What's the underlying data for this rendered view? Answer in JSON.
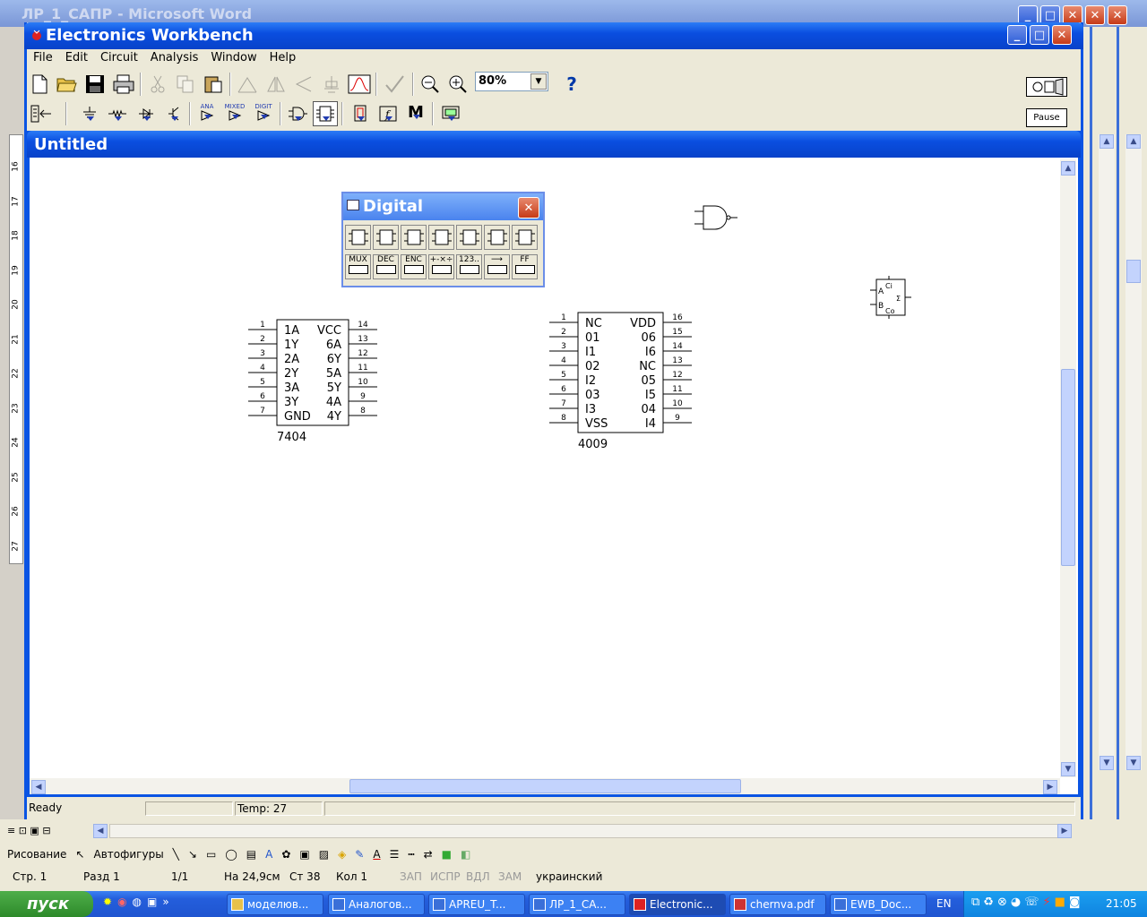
{
  "word": {
    "title": "ЛР_1_САПР - Microsoft Word",
    "status": [
      "Стр. 1",
      "Разд 1",
      "1/1",
      "На 24,9см",
      "Ст 38",
      "Кол 1",
      "ЗАП",
      "ИСПР",
      "ВДЛ",
      "ЗАМ",
      "украинский"
    ],
    "drawing_label": "Рисование",
    "autoshapes_label": "Автофигуры",
    "ruler_numbers": [
      "16",
      "17",
      "18",
      "19",
      "20",
      "21",
      "22",
      "23",
      "24",
      "25",
      "26",
      "27"
    ]
  },
  "ewb": {
    "title": "Electronics Workbench",
    "menu": [
      "File",
      "Edit",
      "Circuit",
      "Analysis",
      "Window",
      "Help"
    ],
    "zoom": "80%",
    "help_label": "?",
    "pause_label": "Pause",
    "parts_bins": [
      "ANA",
      "MIXED",
      "DIGIT"
    ],
    "m_label": "M"
  },
  "circuit_window": {
    "title": "Untitled"
  },
  "status": {
    "ready": "Ready",
    "temp": "Temp:  27"
  },
  "digital_palette": {
    "title": "Digital",
    "bottom_labels": [
      "MUX",
      "DEC",
      "ENC",
      "+-×÷",
      "123..",
      "⟶",
      "FF"
    ]
  },
  "chip_7404": {
    "name": "7404",
    "left_labels": [
      "1A",
      "1Y",
      "2A",
      "2Y",
      "3A",
      "3Y",
      "GND"
    ],
    "right_labels": [
      "VCC",
      "6A",
      "6Y",
      "5A",
      "5Y",
      "4A",
      "4Y"
    ],
    "left_pins": [
      "1",
      "2",
      "3",
      "4",
      "5",
      "6",
      "7"
    ],
    "right_pins": [
      "14",
      "13",
      "12",
      "11",
      "10",
      "9",
      "8"
    ]
  },
  "chip_4009": {
    "name": "4009",
    "left_labels": [
      "NC",
      "01",
      "I1",
      "02",
      "I2",
      "03",
      "I3",
      "VSS"
    ],
    "right_labels": [
      "VDD",
      "06",
      "I6",
      "NC",
      "05",
      "I5",
      "04",
      "I4"
    ],
    "left_pins": [
      "1",
      "2",
      "3",
      "4",
      "5",
      "6",
      "7",
      "8"
    ],
    "right_pins": [
      "16",
      "15",
      "14",
      "13",
      "12",
      "11",
      "10",
      "9"
    ]
  },
  "adder": {
    "a": "A",
    "b": "B",
    "ci": "Ci",
    "co": "Co",
    "sum": "Σ"
  },
  "taskbar": {
    "start": "пуск",
    "tasks": [
      "моделюв...",
      "Аналогов...",
      "APREU_T...",
      "ЛР_1_СА...",
      "Electronic...",
      "chernva.pdf",
      "EWB_Doc..."
    ],
    "lang": "EN",
    "clock": "21:05"
  },
  "colors": {
    "xp_blue": "#0a54e3",
    "face": "#ece9d8"
  }
}
